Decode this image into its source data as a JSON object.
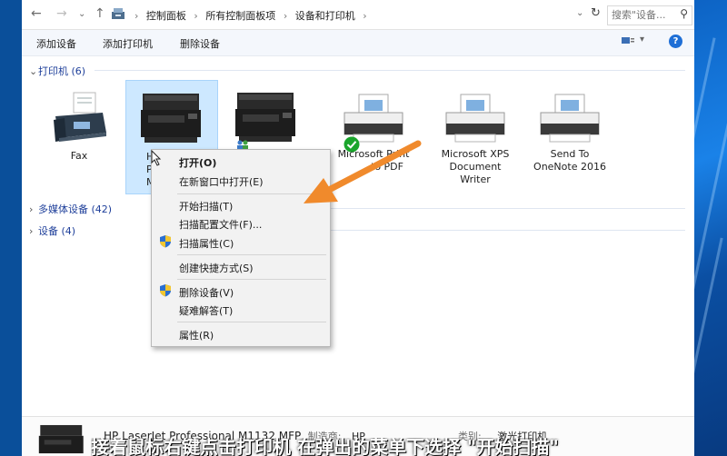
{
  "addressbar": {
    "crumbs": [
      "控制面板",
      "所有控制面板项",
      "设备和打印机"
    ],
    "search_placeholder": "搜索\"设备...",
    "back_icon": "back-arrow-icon",
    "forward_icon": "forward-arrow-icon",
    "up_icon": "up-arrow-icon",
    "refresh_icon": "refresh-icon"
  },
  "toolbar": {
    "add_device": "添加设备",
    "add_printer": "添加打印机",
    "remove_device": "删除设备",
    "help": "?"
  },
  "groups": {
    "printers": "打印机 (6)",
    "media": "多媒体设备 (42)",
    "devices": "设备 (4)"
  },
  "printers": [
    {
      "label_lines": [
        "Fax"
      ],
      "icon": "fax-icon"
    },
    {
      "label_lines": [
        "HP",
        "Pr",
        "M"
      ],
      "icon": "mfp-printer-icon",
      "selected": true
    },
    {
      "label_lines": [],
      "icon": "mfp-printer-icon"
    },
    {
      "label_lines": [
        "Microsoft Print",
        "to PDF"
      ],
      "icon": "printer-icon",
      "default": true
    },
    {
      "label_lines": [
        "Microsoft XPS",
        "Document",
        "Writer"
      ],
      "icon": "printer-icon"
    },
    {
      "label_lines": [
        "Send To",
        "OneNote 2016"
      ],
      "icon": "printer-icon"
    }
  ],
  "context_menu": {
    "open": "打开(O)",
    "open_new": "在新窗口中打开(E)",
    "start_scan": "开始扫描(T)",
    "scan_profiles": "扫描配置文件(F)...",
    "scan_props": "扫描属性(C)",
    "create_shortcut": "创建快捷方式(S)",
    "remove": "删除设备(V)",
    "troubleshoot": "疑难解答(T)",
    "properties": "属性(R)"
  },
  "details": {
    "name": "HP LaserJet Professional M1132 MFP",
    "maker_key": "制造商:",
    "maker_val": "HP",
    "category_key": "类别:",
    "category_val": "激光打印机"
  },
  "subtitle": "接着鼠标右键点击打印机 在弹出的菜单下选择 \"开始扫描\"",
  "colors": {
    "accent": "#1e3f9a",
    "arrow": "#f08a2c",
    "selection": "#cde8ff",
    "help": "#1f6fd6",
    "default_check": "#1aa52c"
  }
}
